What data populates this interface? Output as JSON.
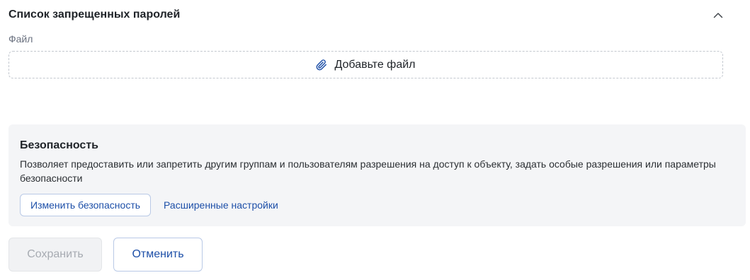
{
  "section": {
    "title": "Список запрещенных паролей",
    "collapse_icon": "chevron-up-icon"
  },
  "file": {
    "label": "Файл",
    "dropzone_text": "Добавьте файл",
    "dropzone_icon": "paperclip-icon"
  },
  "security": {
    "title": "Безопасность",
    "description": "Позволяет предоставить или запретить другим группам и пользователям разрешения на доступ к объекту, задать особые разрешения или параметры безопасности",
    "change_button": "Изменить безопасность",
    "advanced_button": "Расширенные настройки"
  },
  "footer": {
    "save_label": "Сохранить",
    "save_enabled": false,
    "cancel_label": "Отменить"
  },
  "colors": {
    "accent": "#1d4fa8",
    "card_background": "#f4f5f7",
    "disabled_text": "#a7abb2"
  }
}
